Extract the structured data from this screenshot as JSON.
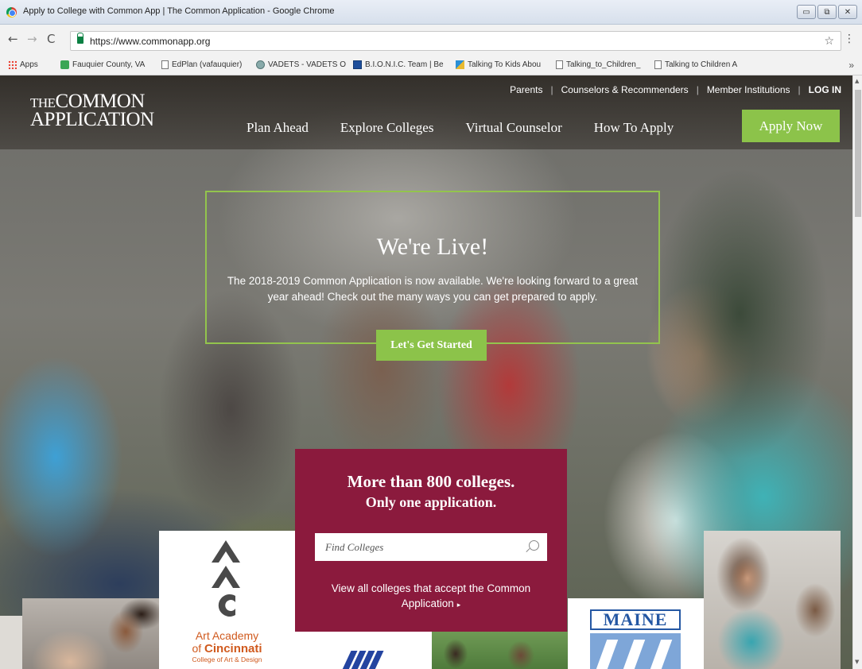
{
  "browser": {
    "window_title": "Apply to College with Common App | The Common Application - Google Chrome",
    "url": "https://www.commonapp.org",
    "bookmarks": [
      {
        "label": "Apps",
        "icon": "apps-grid-icon"
      },
      {
        "label": "Fauquier County, VA",
        "icon": "green-square-icon"
      },
      {
        "label": "EdPlan (vafauquier)",
        "icon": "page-icon"
      },
      {
        "label": "VADETS - VADETS O",
        "icon": "globe-icon"
      },
      {
        "label": "B.I.O.N.I.C. Team | Be",
        "icon": "grid-icon"
      },
      {
        "label": "Talking To Kids Abou",
        "icon": "arrow-icon"
      },
      {
        "label": "Talking_to_Children_",
        "icon": "page-icon"
      },
      {
        "label": "Talking to Children A",
        "icon": "page-icon"
      }
    ],
    "bookmarks_overflow": "»"
  },
  "header": {
    "logo_the": "THE",
    "logo_common": "COMMON",
    "logo_application": "APPLICATION",
    "utility_links": [
      "Parents",
      "Counselors & Recommenders",
      "Member Institutions"
    ],
    "login_label": "LOG IN",
    "nav": [
      "Plan Ahead",
      "Explore Colleges",
      "Virtual Counselor",
      "How To Apply"
    ],
    "apply_label": "Apply Now"
  },
  "hero": {
    "title": "We're Live!",
    "text": "The 2018-2019 Common Application is now available. We're looking forward to a great year ahead! Check out the many ways you can get prepared to apply.",
    "cta_label": "Let's Get Started"
  },
  "search": {
    "heading_line1": "More than 800 colleges.",
    "heading_line2": "Only one application.",
    "placeholder": "Find Colleges",
    "view_all": "View all colleges that accept the Common Application",
    "view_all_arrow": "▸"
  },
  "tiles": {
    "aac_line1": "Art Academy",
    "aac_of": "of ",
    "aac_name": "Cincinnati",
    "aac_line3": "College of Art & Design",
    "maine": "MAINE"
  },
  "colors": {
    "accent_green": "#8cc34a",
    "panel_maroon": "#8b1a3d",
    "aac_orange": "#d05a1e",
    "maine_blue": "#2457a3"
  }
}
